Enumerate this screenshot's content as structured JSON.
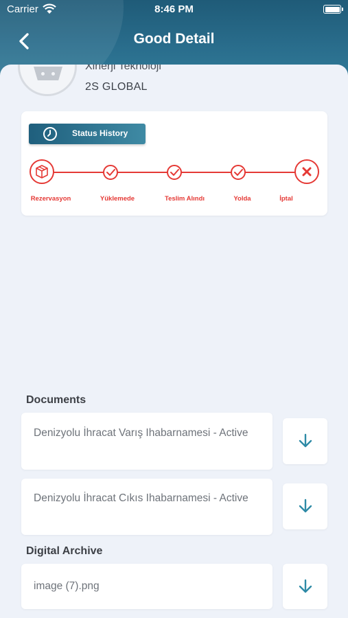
{
  "status_bar": {
    "carrier": "Carrier",
    "time": "8:46 PM"
  },
  "nav": {
    "title": "Good Detail"
  },
  "company": {
    "name": "Xinerji Teknoloji",
    "sub": "2S GLOBAL"
  },
  "status_history": {
    "button_label": "Status History",
    "steps": [
      {
        "label": "Rezervasyon",
        "icon": "package-icon"
      },
      {
        "label": "Yüklemede",
        "icon": "check-icon"
      },
      {
        "label": "Teslim Alındı",
        "icon": "check-icon"
      },
      {
        "label": "Yolda",
        "icon": "check-icon"
      },
      {
        "label": "İptal",
        "icon": "x-icon"
      }
    ],
    "color": "#e53935"
  },
  "documents": {
    "title": "Documents",
    "items": [
      {
        "name": "Denizyolu İhracat Varış Ihabarnamesi - Active"
      },
      {
        "name": "Denizyolu İhracat Cıkıs Ihabarnamesi - Active"
      }
    ]
  },
  "digital_archive": {
    "title": "Digital Archive",
    "items": [
      {
        "name": "image (7).png"
      }
    ]
  },
  "colors": {
    "header": "#2a6e8d",
    "accent": "#2e8aa6",
    "status": "#e53935"
  }
}
